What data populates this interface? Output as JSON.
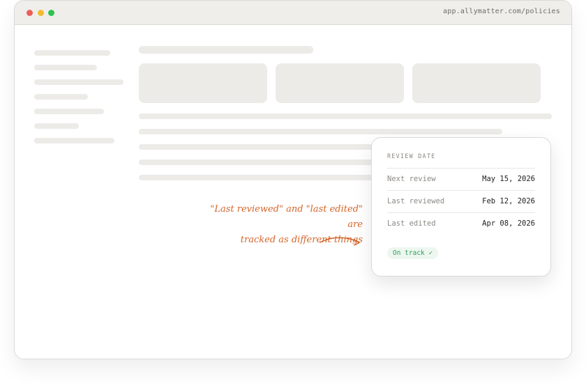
{
  "window": {
    "url": "app.allymatter.com/policies",
    "dot_colors": [
      "#ec5f57",
      "#f3bb2e",
      "#2fc24d"
    ]
  },
  "review_card": {
    "heading": "REVIEW DATE",
    "rows": [
      {
        "label": "Next review",
        "value": "May 15, 2026"
      },
      {
        "label": "Last reviewed",
        "value": "Feb 12, 2026"
      },
      {
        "label": "Last edited",
        "value": "Apr 08, 2026"
      }
    ],
    "status": "On track ✓",
    "status_color": "#2e9d5a"
  },
  "annotation": {
    "line1": "\"Last reviewed\" and \"last edited\" are",
    "line2": "tracked as different things",
    "color": "#d4652a",
    "icon": "curved-arrow-icon"
  }
}
